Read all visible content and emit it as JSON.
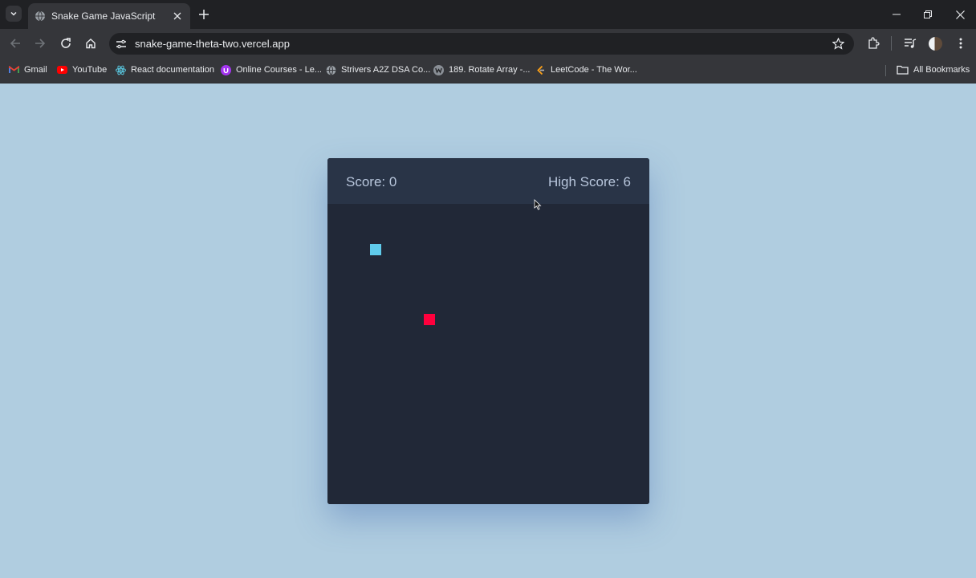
{
  "browser": {
    "tab": {
      "title": "Snake Game JavaScript"
    },
    "address_bar": {
      "url": "snake-game-theta-two.vercel.app"
    },
    "icons": [
      "tab-search-icon",
      "globe-icon",
      "close-icon",
      "plus-icon",
      "minimize-icon",
      "restore-icon",
      "back-icon",
      "forward-icon",
      "reload-icon",
      "home-icon",
      "site-info-icon",
      "star-icon",
      "extensions-icon",
      "media-control-icon",
      "menu-icon",
      "folder-icon"
    ],
    "bookmarks": [
      {
        "label": "Gmail",
        "icon": "gmail-icon"
      },
      {
        "label": "YouTube",
        "icon": "youtube-icon"
      },
      {
        "label": "React documentation",
        "icon": "react-icon"
      },
      {
        "label": "Online Courses - Le...",
        "icon": "udemy-icon"
      },
      {
        "label": "Strivers A2Z DSA Co...",
        "icon": "globe-icon"
      },
      {
        "label": "189. Rotate Array -...",
        "icon": "w-icon"
      },
      {
        "label": "LeetCode - The Wor...",
        "icon": "leetcode-icon"
      }
    ],
    "all_bookmarks_label": "All Bookmarks"
  },
  "game": {
    "score_text": "Score: 0",
    "high_score_text": "High Score: 6",
    "colors": {
      "snake": "#60cbeb",
      "food": "#ff003d",
      "board": "#212837",
      "details_bar": "#293447",
      "page_bg": "#b0cde0"
    }
  }
}
